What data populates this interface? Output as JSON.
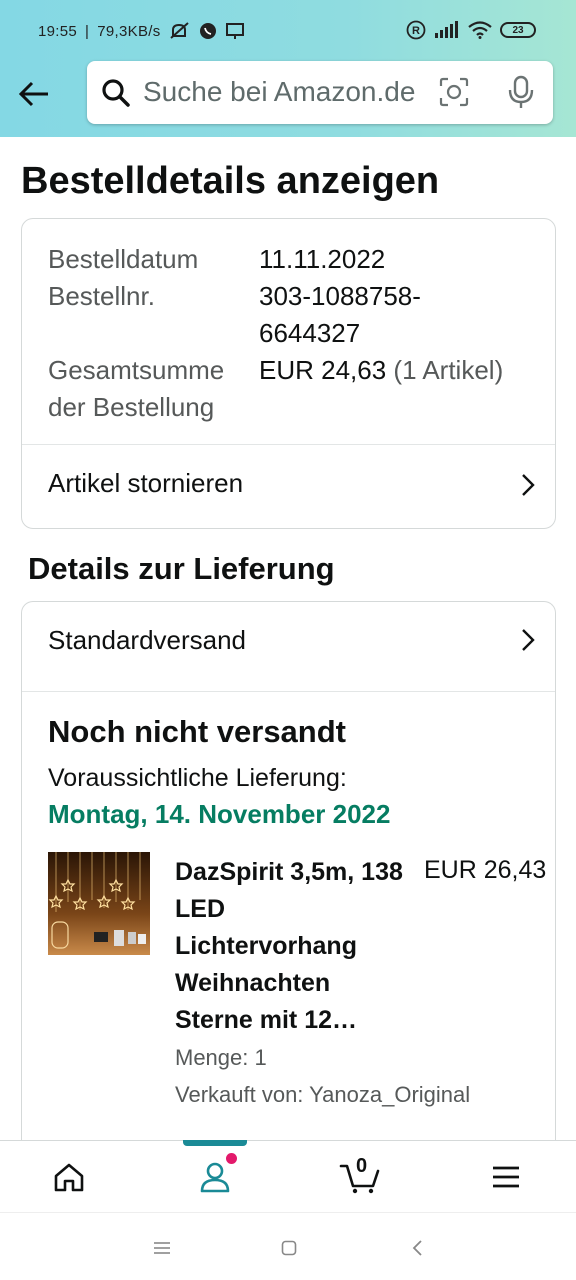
{
  "status_bar": {
    "time": "19:55",
    "separator": "|",
    "net_speed": "79,3KB/s",
    "battery": "23",
    "icons": [
      "mute-icon",
      "whatsapp-icon",
      "screen-icon",
      "registered-icon",
      "signal-icon",
      "wifi-icon",
      "battery-icon"
    ]
  },
  "header": {
    "search_placeholder": "Suche bei Amazon.de",
    "icons": [
      "back-arrow-icon",
      "search-icon",
      "camera-scan-icon",
      "microphone-icon"
    ]
  },
  "page": {
    "title": "Bestelldetails anzeigen"
  },
  "order_summary": {
    "date_label": "Bestelldatum",
    "date_value": "11.11.2022",
    "number_label": "Bestellnr.",
    "number_value_line1": "303-1088758-",
    "number_value_line2": "6644327",
    "total_label_line1": "Gesamtsumme",
    "total_label_line2": "der Bestellung",
    "total_value": "EUR 24,63",
    "total_items": "(1 Artikel)",
    "cancel_link": "Artikel stornieren"
  },
  "delivery": {
    "section_title": "Details zur Lieferung",
    "shipping_method": "Standardversand",
    "status": "Noch nicht versandt",
    "eta_label": "Voraussichtliche Lieferung:",
    "eta_date": "Montag, 14. November 2022",
    "item": {
      "title": "DazSpirit 3,5m, 138 LED Lichtervorhang Weihnachten Sterne mit 12…",
      "price": "EUR 26,43",
      "quantity": "Menge: 1",
      "seller": "Verkauft von: Yanoza_Original"
    }
  },
  "bottom_nav": {
    "cart_count": "0",
    "items": [
      "home-icon",
      "account-icon",
      "cart-icon",
      "menu-icon"
    ]
  },
  "colors": {
    "header_gradient_start": "#84d8e4",
    "header_gradient_end": "#a6e6d4",
    "eta_green": "#067d62",
    "nav_accent": "#1a8a96",
    "notif_pink": "#e3196b"
  }
}
